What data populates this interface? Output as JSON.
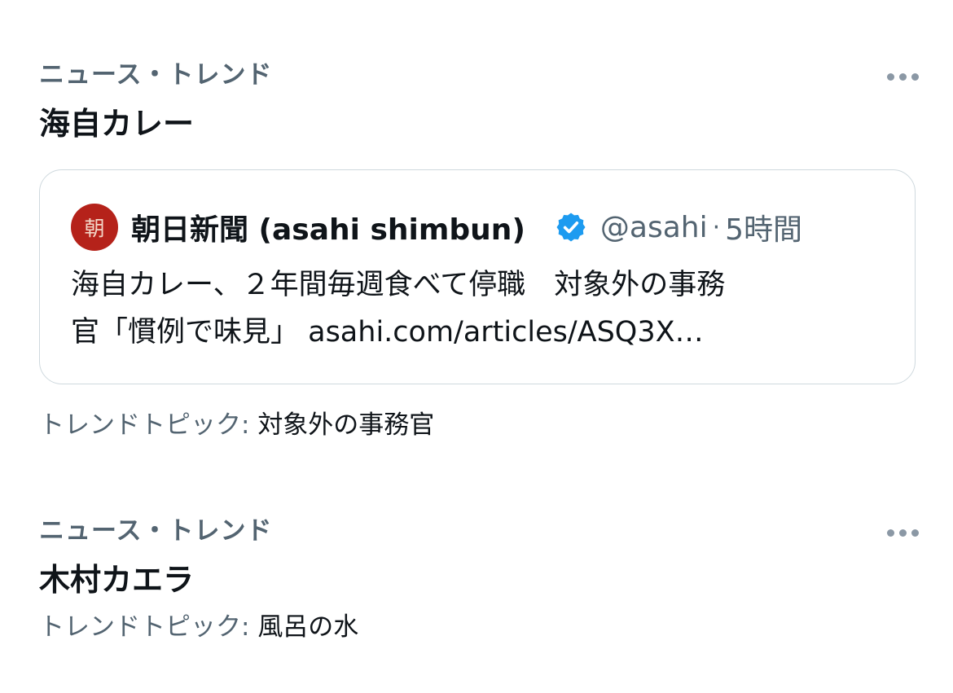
{
  "trends": [
    {
      "meta": "ニュース・トレンド",
      "title": "海自カレー",
      "card": {
        "avatar_text": "朝",
        "author": "朝日新聞 (asahi shimbun)",
        "handle": "@asahi",
        "separator": "·",
        "time": "5時間",
        "line1": "海自カレー、２年間毎週食べて停職　対象外の事務",
        "line2": "官「慣例で味見」 asahi.com/articles/ASQ3X…",
        "verified_color": "#1d9bf0"
      },
      "topic_label": "トレンドトピック:",
      "topic_value": "対象外の事務官"
    },
    {
      "meta": "ニュース・トレンド",
      "title": "木村カエラ",
      "topic_label": "トレンドトピック:",
      "topic_value": "風呂の水"
    }
  ],
  "icons": {
    "more": "more-horizontal-icon",
    "verified": "verified-badge-icon"
  }
}
